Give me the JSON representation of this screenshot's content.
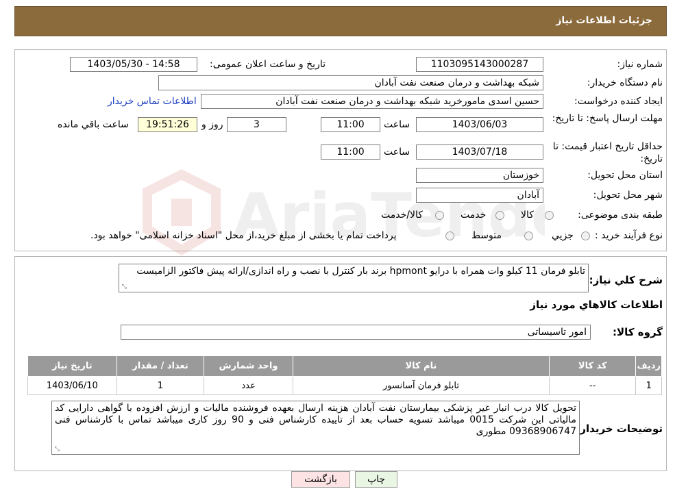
{
  "header": {
    "title": "جزئیات اطلاعات نیاز"
  },
  "fields": {
    "need_number_label": "شماره نیاز:",
    "need_number": "1103095143000287",
    "announce_label": "تاریخ و ساعت اعلان عمومی:",
    "announce_value": "1403/05/30 - 14:58",
    "buyer_org_label": "نام دستگاه خریدار:",
    "buyer_org": "شبکه بهداشت و درمان صنعت نفت آبادان",
    "creator_label": "ایجاد کننده درخواست:",
    "creator": "حسین اسدی مامورخرید شبکه بهداشت و درمان صنعت نفت آبادان",
    "contact_link": "اطلاعات تماس خریدار",
    "deadline_label": "مهلت ارسال پاسخ: تا تاریخ:",
    "deadline_date": "1403/06/03",
    "time_label": "ساعت",
    "deadline_time": "11:00",
    "days_value": "3",
    "days_label": "روز و",
    "remaining_time": "19:51:26",
    "remaining_label": "ساعت باقي مانده",
    "price_validity_label": "حداقل تاریخ اعتبار قیمت: تا تاریخ:",
    "price_validity_date": "1403/07/18",
    "price_validity_time": "11:00",
    "province_label": "استان محل تحویل:",
    "province": "خوزستان",
    "city_label": "شهر محل تحویل:",
    "city": "آبادان",
    "category_label": "طبقه بندی موضوعی:",
    "category_options": [
      "کالا",
      "خدمت",
      "کالا/خدمت"
    ],
    "process_label": "نوع فرآیند خرید :",
    "process_options": [
      "جزيي",
      "متوسط"
    ],
    "process_note": "پرداخت تمام یا بخشی از مبلغ خرید،از محل \"اسناد خزانه اسلامی\" خواهد بود."
  },
  "summary": {
    "label": "شرح کلي نياز:",
    "text": "تابلو فرمان 11 کیلو وات همراه با درایو hpmont برند بار کنترل با نصب و راه اندازی/ارائه پیش فاکتور الزامیست"
  },
  "goods": {
    "section_title": "اطلاعات کالاهاي مورد نياز",
    "group_label": "گروه کالا:",
    "group_value": "امور تاسیساتی",
    "columns": [
      "رديف",
      "کد کالا",
      "نام کالا",
      "واحد شمارش",
      "تعداد / مقدار",
      "تاریخ نیاز"
    ],
    "rows": [
      [
        "1",
        "--",
        "تابلو فرمان آسانسور",
        "عدد",
        "1",
        "1403/06/10"
      ]
    ]
  },
  "buyer_notes": {
    "label": "توضیحات خریدار:",
    "text": "تحویل کالا درب انبار غیر پزشکی بیمارستان نفت آبادان هزینه ارسال بعهده فروشنده مالیات و ارزش افزوده با گواهی دارایی کد مالیاتی این شرکت 0015 میباشد  تسویه حساب بعد از تاییده کارشناس فنی و 90 روز کاری میباشد تماس با کارشناس فنی 09368906747 مطوری"
  },
  "buttons": {
    "print": "چاپ",
    "back": "بازگشت"
  },
  "watermark": {
    "text": "AriaTender.neT"
  },
  "colors": {
    "header_bg": "#8b6a3c",
    "table_header": "#9a9a9a",
    "back_button": "#fde3e3",
    "print_button": "#eaf6e4",
    "link": "#1a3cc0"
  }
}
